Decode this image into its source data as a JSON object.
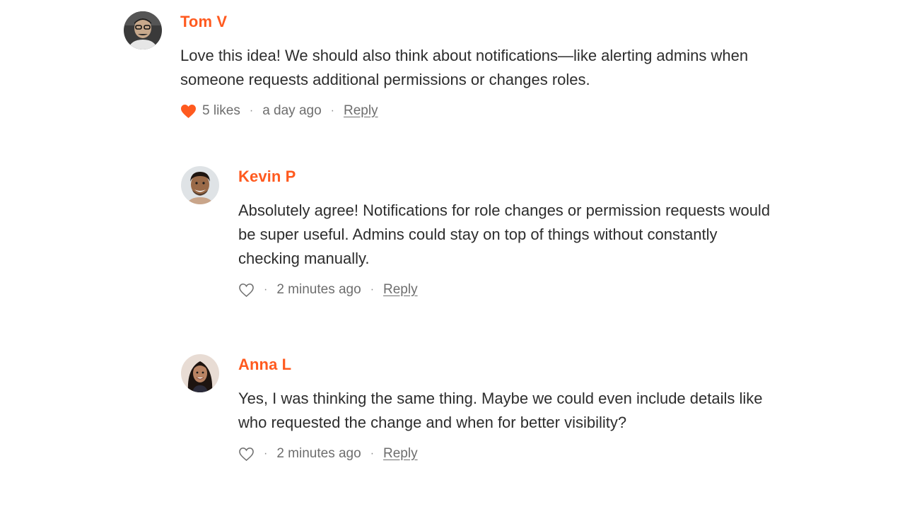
{
  "colors": {
    "author_accent": "#ff5a1f",
    "liked_heart": "#ff5a1f",
    "text": "#2d2d2d",
    "meta_text": "#6e6e6e"
  },
  "comments": [
    {
      "author": "Tom V",
      "avatar_icon": "avatar-photo-tom",
      "body": "Love this idea! We should also think about notifications—like alerting admins when someone requests additional permissions or changes roles.",
      "liked": true,
      "heart_icon": "heart-filled-icon",
      "likes_text": "5 likes",
      "timestamp": "a day ago",
      "reply_label": "Reply"
    },
    {
      "author": "Kevin P",
      "avatar_icon": "avatar-photo-kevin",
      "body": "Absolutely agree! Notifications for role changes or permission requests would be super useful. Admins could stay on top of things without constantly checking manually.",
      "liked": false,
      "heart_icon": "heart-outline-icon",
      "timestamp": "2 minutes ago",
      "reply_label": "Reply"
    },
    {
      "author": "Anna L",
      "avatar_icon": "avatar-photo-anna",
      "body": "Yes, I was thinking the same thing. Maybe we could even include details like who requested the change and when for better visibility?",
      "liked": false,
      "heart_icon": "heart-outline-icon",
      "timestamp": "2 minutes ago",
      "reply_label": "Reply"
    }
  ]
}
